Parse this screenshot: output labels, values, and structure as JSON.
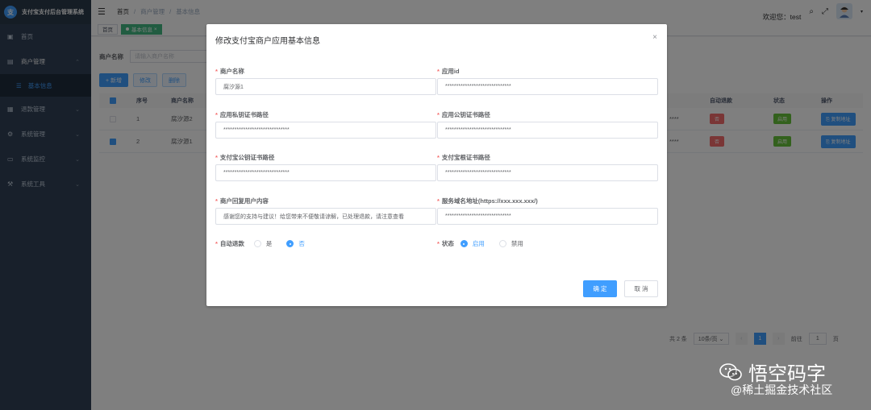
{
  "app": {
    "title": "支付宝支付后台管理系统",
    "logo_glyph": "支"
  },
  "sidebar": {
    "items": [
      {
        "label": "首页",
        "icon": "dashboard-icon"
      },
      {
        "label": "商户管理",
        "icon": "store-icon"
      },
      {
        "label": "基本信息",
        "icon": "list-icon"
      },
      {
        "label": "退款管理",
        "icon": "refund-icon"
      },
      {
        "label": "系统管理",
        "icon": "gear-icon"
      },
      {
        "label": "系统监控",
        "icon": "monitor-icon"
      },
      {
        "label": "系统工具",
        "icon": "tool-icon"
      }
    ]
  },
  "navbar": {
    "breadcrumb": [
      "首页",
      "商户管理",
      "基本信息"
    ],
    "separator": "/",
    "welcome": "欢迎您：test"
  },
  "tags": [
    "首页",
    "基本信息"
  ],
  "search": {
    "label": "商户名称",
    "placeholder": "请输入商户名称"
  },
  "toolbar": {
    "add": "+ 新增",
    "edit": "修改",
    "delete": "删除"
  },
  "table": {
    "headers": {
      "index": "序号",
      "name": "商户名称",
      "refund": "自动退款",
      "status": "状态",
      "ops": "操作"
    },
    "rows": [
      {
        "index": "1",
        "name": "腐汐源2",
        "mask": "****",
        "refund": "否",
        "status": "启用",
        "op": "复制地址",
        "checked": false
      },
      {
        "index": "2",
        "name": "腐汐源1",
        "mask": "****",
        "refund": "否",
        "status": "启用",
        "op": "复制地址",
        "checked": true
      }
    ]
  },
  "pagination": {
    "total": "共 2 条",
    "page_size": "10条/页",
    "current": "1",
    "goto_label": "前往",
    "goto_value": "1",
    "page_suffix": "页"
  },
  "dialog": {
    "title": "修改支付宝商户应用基本信息",
    "fields": {
      "merchant_name": {
        "label": "商户名称",
        "value": "腐汐源1"
      },
      "app_id": {
        "label": "应用id",
        "value": "******************************"
      },
      "app_private_cert": {
        "label": "应用私钥证书路径",
        "value": "******************************"
      },
      "app_public_cert": {
        "label": "应用公钥证书路径",
        "value": "******************************"
      },
      "alipay_public_cert": {
        "label": "支付宝公钥证书路径",
        "value": "******************************"
      },
      "alipay_root_cert": {
        "label": "支付宝根证书路径",
        "value": "******************************"
      },
      "reply_content": {
        "label": "商户回复用户内容",
        "value": "感谢您的支持与建议！给您带来不便敬请谅解，已处理退款，请注意查看"
      },
      "domain": {
        "label": "服务域名地址(https://xxx.xxx.xxx/)",
        "value": "******************************"
      }
    },
    "auto_refund": {
      "label": "自动退款",
      "options": [
        "是",
        "否"
      ],
      "selected": "否"
    },
    "status": {
      "label": "状态",
      "options": [
        "启用",
        "禁用"
      ],
      "selected": "启用"
    },
    "ok": "确 定",
    "cancel": "取 消"
  },
  "watermark": {
    "title": "悟空码字",
    "sub": "@稀土掘金技术社区"
  }
}
